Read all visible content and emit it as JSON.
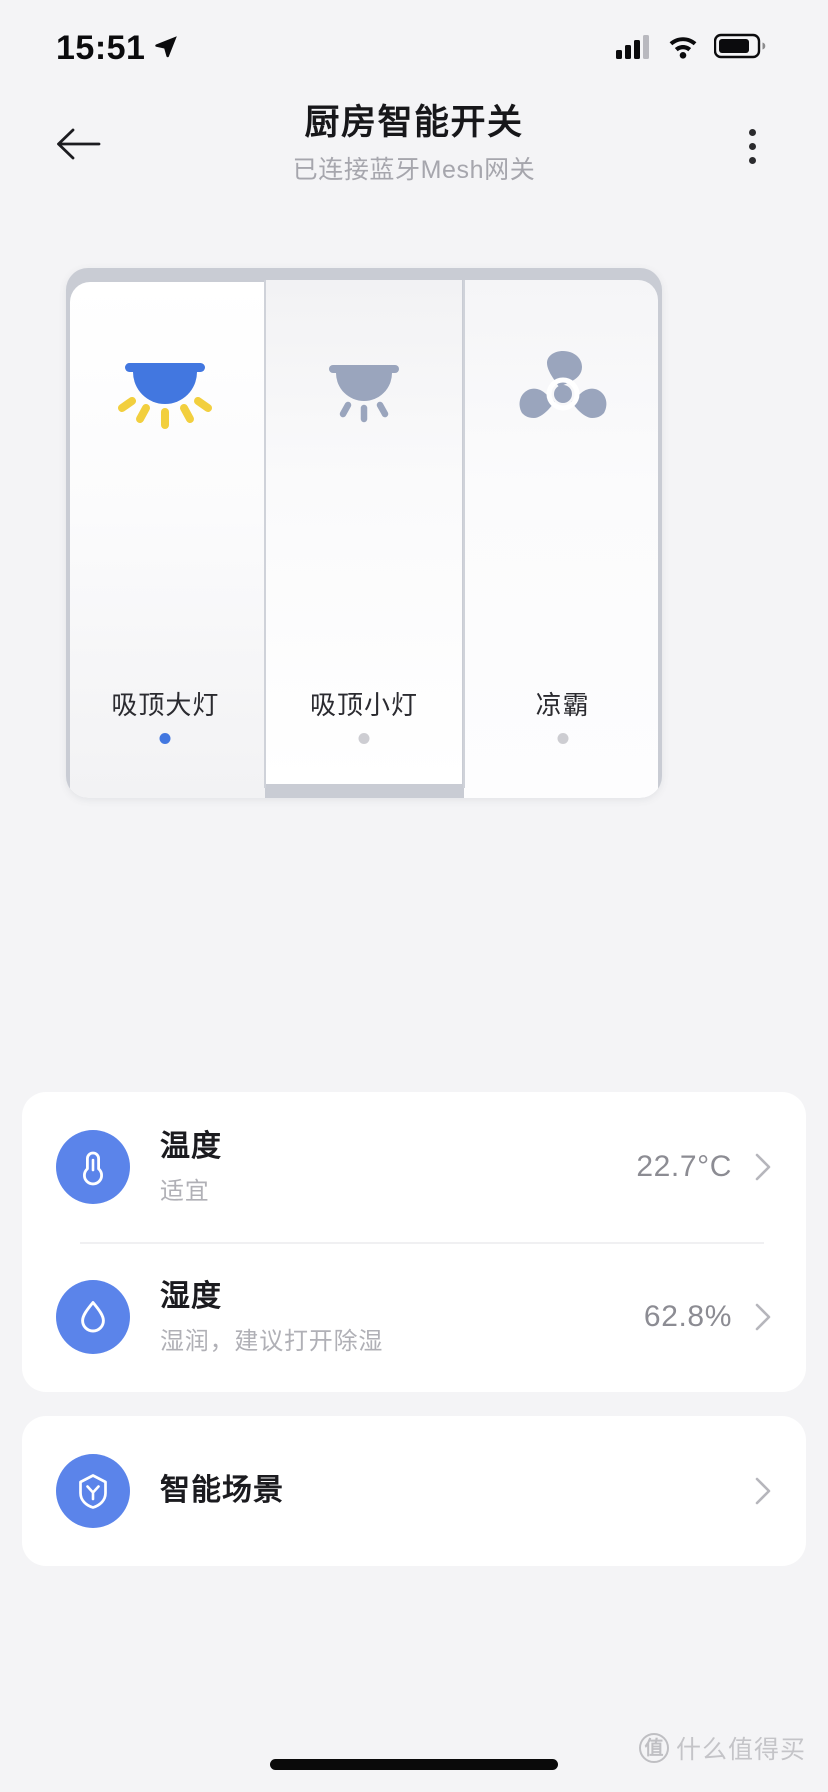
{
  "status_bar": {
    "time": "15:51",
    "location_icon": "location-arrow-icon",
    "cellular_icon": "cellular-signal-icon",
    "wifi_icon": "wifi-icon",
    "battery_icon": "battery-icon"
  },
  "nav": {
    "back_icon": "back-arrow-icon",
    "title": "厨房智能开关",
    "subtitle": "已连接蓝牙Mesh网关",
    "more_icon": "more-vertical-icon"
  },
  "switch_panel": {
    "keys": [
      {
        "label": "吸顶大灯",
        "icon": "ceiling-lamp-icon",
        "state": "on",
        "dot_color": "#4277e0"
      },
      {
        "label": "吸顶小灯",
        "icon": "ceiling-lamp-icon",
        "state": "off",
        "dot_color": "#cdcdd2"
      },
      {
        "label": "凉霸",
        "icon": "fan-icon",
        "state": "off",
        "dot_color": "#cdcdd2"
      }
    ]
  },
  "sensors": [
    {
      "icon": "thermometer-icon",
      "title": "温度",
      "subtitle": "适宜",
      "value": "22.7°C",
      "chevron": "chevron-right-icon"
    },
    {
      "icon": "water-drop-icon",
      "title": "湿度",
      "subtitle": "湿润，建议打开除湿",
      "value": "62.8%",
      "chevron": "chevron-right-icon"
    }
  ],
  "scene": {
    "icon": "shield-scene-icon",
    "title": "智能场景",
    "chevron": "chevron-right-icon"
  },
  "watermark": {
    "badge": "值",
    "text": "什么值得买"
  },
  "colors": {
    "accent_blue": "#4277e0",
    "icon_circle_blue": "#5b84ea",
    "lamp_ray_yellow": "#f2cf3e",
    "inactive_gray": "#9aa5bd",
    "panel_frame": "#c9ccd4",
    "page_bg": "#f4f4f6"
  }
}
